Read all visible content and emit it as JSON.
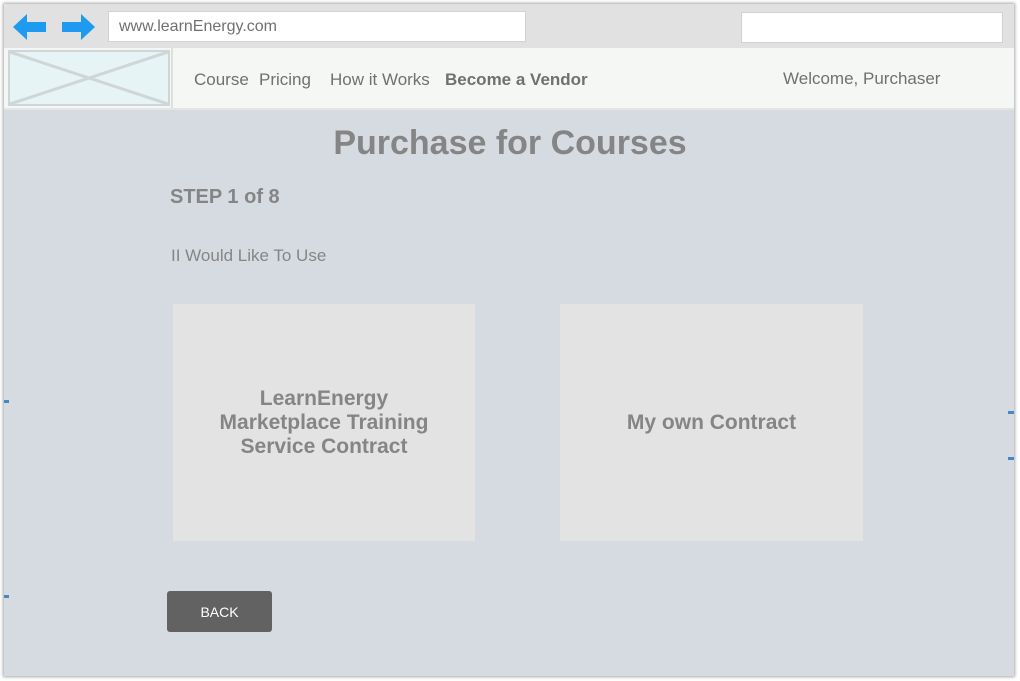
{
  "browser": {
    "url": "www.learnEnergy.com",
    "search_value": "",
    "back_icon": "arrow-left-icon",
    "forward_icon": "arrow-right-icon",
    "arrow_color": "#1e9bf0"
  },
  "header": {
    "nav": [
      "Course",
      "Pricing",
      "How it Works",
      "Become a Vendor"
    ],
    "welcome": "Welcome, Purchaser"
  },
  "main": {
    "title": "Purchase for Courses",
    "step": "STEP 1 of 8",
    "prompt": "II Would Like To Use",
    "options": [
      "LearnEnergy Marketplace Training Service Contract",
      "My own Contract"
    ],
    "back_label": "BACK"
  },
  "colors": {
    "page_background": "#d6dbe2",
    "card_background": "#e3e3e3",
    "text_gray": "#858585",
    "button_background": "#626262"
  }
}
